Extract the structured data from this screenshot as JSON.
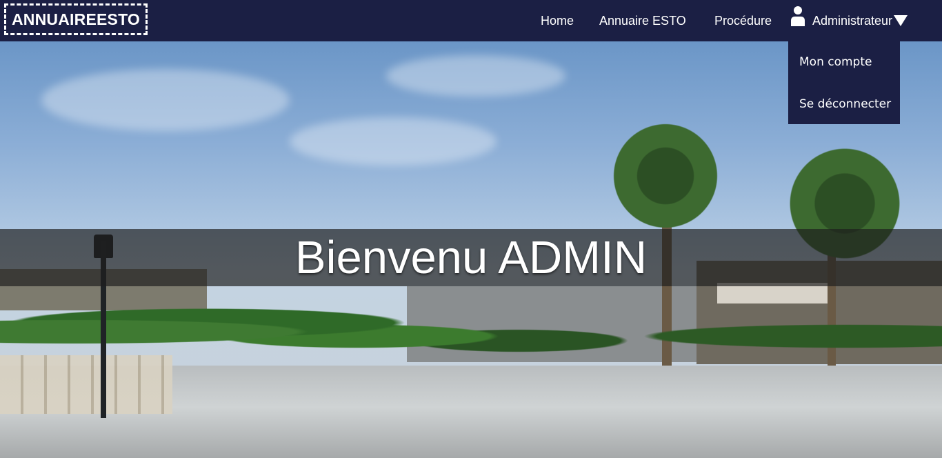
{
  "logo": {
    "text": "ANNUAIREESTO"
  },
  "nav": {
    "home": "Home",
    "annuaire": "Annuaire ESTO",
    "procedure": "Procédure",
    "admin": "Administrateur"
  },
  "dropdown": {
    "account": "Mon compte",
    "logout": "Se déconnecter"
  },
  "hero": {
    "welcome": "Bienvenu ADMIN"
  },
  "colors": {
    "navbar": "#1b1f44",
    "text": "#ffffff"
  },
  "icons": [
    "user-icon",
    "caret-down-icon"
  ]
}
